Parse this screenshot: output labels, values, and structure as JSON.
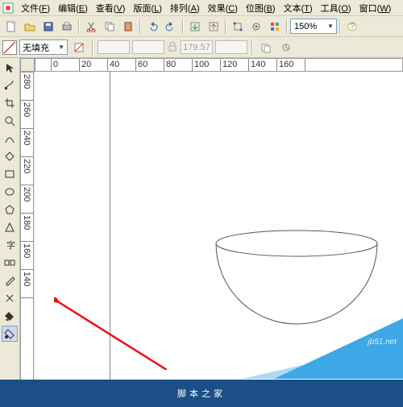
{
  "menu": {
    "items": [
      {
        "label": "文件",
        "key": "F"
      },
      {
        "label": "编辑",
        "key": "E"
      },
      {
        "label": "查看",
        "key": "V"
      },
      {
        "label": "版面",
        "key": "L"
      },
      {
        "label": "排列",
        "key": "A"
      },
      {
        "label": "效果",
        "key": "C"
      },
      {
        "label": "位图",
        "key": "B"
      },
      {
        "label": "文本",
        "key": "T"
      },
      {
        "label": "工具",
        "key": "O"
      },
      {
        "label": "窗口",
        "key": "W"
      }
    ]
  },
  "toolbar1": {
    "icons": [
      "new",
      "open",
      "save",
      "print",
      "cut",
      "copy",
      "paste",
      "undo",
      "redo",
      "import",
      "export",
      "snap",
      "options",
      "help",
      "app-launch"
    ],
    "zoom": "150%"
  },
  "propbar": {
    "fill_label": "无填充",
    "disabled_x": "",
    "disabled_y": "",
    "disabled_w": "179.57",
    "disabled_h": ""
  },
  "ruler": {
    "h": [
      "20",
      "0",
      "20",
      "40",
      "60",
      "80",
      "100",
      "120",
      "140",
      "160"
    ],
    "v": [
      "280",
      "260",
      "240",
      "220",
      "200",
      "180",
      "160",
      "140"
    ]
  },
  "watermark": {
    "url": "jb51.net"
  },
  "footer": {
    "text": "脚本之家"
  }
}
